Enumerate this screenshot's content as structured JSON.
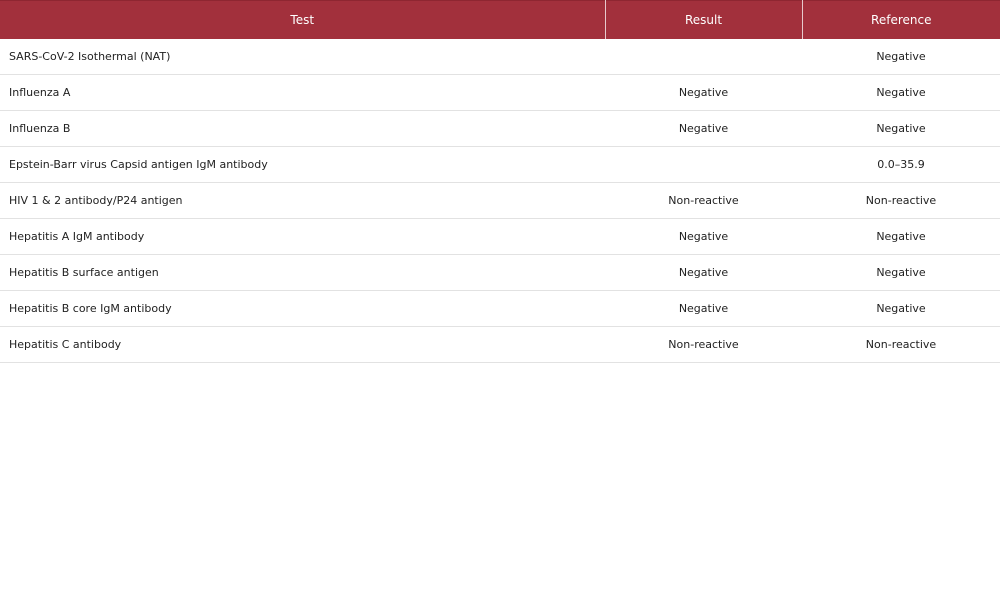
{
  "table": {
    "headers": [
      "Test",
      "Result",
      "Reference"
    ],
    "rows": [
      {
        "test": "SARS-CoV-2 Isothermal (NAT)",
        "result": "",
        "reference": "Negative"
      },
      {
        "test": "Influenza A",
        "result": "Negative",
        "reference": "Negative"
      },
      {
        "test": "Influenza B",
        "result": "Negative",
        "reference": "Negative"
      },
      {
        "test": "Epstein-Barr virus Capsid antigen IgM antibody",
        "result": "",
        "reference": "0.0–35.9"
      },
      {
        "test": "HIV 1 & 2 antibody/P24 antigen",
        "result": "Non-reactive",
        "reference": "Non-reactive"
      },
      {
        "test": "Hepatitis A IgM antibody",
        "result": "Negative",
        "reference": "Negative"
      },
      {
        "test": "Hepatitis B surface antigen",
        "result": "Negative",
        "reference": "Negative"
      },
      {
        "test": "Hepatitis B core IgM antibody",
        "result": "Negative",
        "reference": "Negative"
      },
      {
        "test": "Hepatitis C antibody",
        "result": "Non-reactive",
        "reference": "Non-reactive"
      }
    ]
  },
  "colors": {
    "header_bg": "#a2303c",
    "header_text": "#ffffff",
    "row_border": "#e2e2e2"
  }
}
